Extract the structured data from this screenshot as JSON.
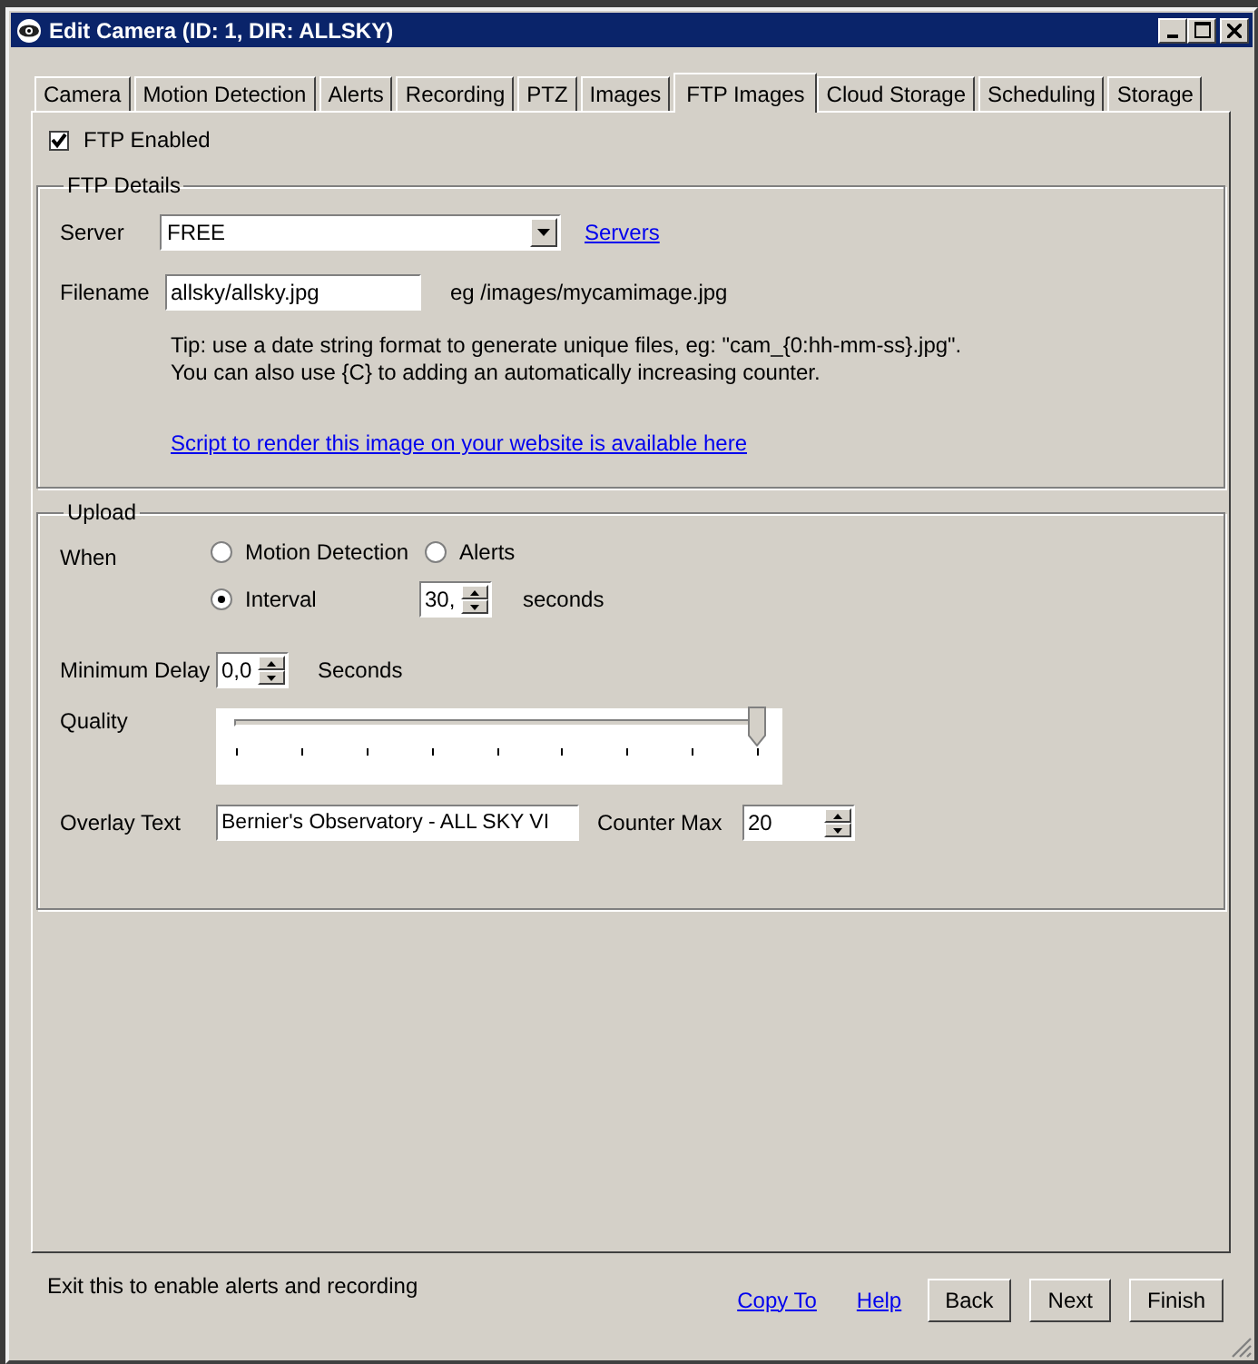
{
  "window": {
    "title": "Edit Camera (ID: 1, DIR: ALLSKY)"
  },
  "tabs": [
    {
      "label": "Camera",
      "selected": false
    },
    {
      "label": "Motion Detection",
      "selected": false
    },
    {
      "label": "Alerts",
      "selected": false
    },
    {
      "label": "Recording",
      "selected": false
    },
    {
      "label": "PTZ",
      "selected": false
    },
    {
      "label": "Images",
      "selected": false
    },
    {
      "label": "FTP Images",
      "selected": true
    },
    {
      "label": "Cloud Storage",
      "selected": false
    },
    {
      "label": "Scheduling",
      "selected": false
    },
    {
      "label": "Storage",
      "selected": false
    }
  ],
  "ftp_enabled": {
    "label": "FTP Enabled",
    "checked": true
  },
  "ftp_details": {
    "title": "FTP Details",
    "server": {
      "label": "Server",
      "value": "FREE"
    },
    "servers_link": "Servers",
    "filename": {
      "label": "Filename",
      "value": "allsky/allsky.jpg"
    },
    "example": "eg /images/mycamimage.jpg",
    "tip": "Tip: use a date string format to generate unique files, eg: \"cam_{0:hh-mm-ss}.jpg\".\nYou can also use {C} to adding an automatically increasing counter.",
    "script_link": "Script to render this image on your website is available here"
  },
  "upload": {
    "title": "Upload",
    "when_label": "When",
    "options": [
      {
        "label": "Motion Detection",
        "selected": false
      },
      {
        "label": "Alerts",
        "selected": false
      },
      {
        "label": "Interval",
        "selected": true
      }
    ],
    "interval": {
      "value": "30,",
      "unit": "seconds"
    },
    "min_delay": {
      "label": "Minimum Delay",
      "value": "0,0",
      "unit": "Seconds"
    },
    "quality": {
      "label": "Quality",
      "level": 1
    },
    "overlay": {
      "label": "Overlay Text",
      "value": "Bernier's Observatory - ALL SKY VI"
    },
    "counter_max": {
      "label": "Counter Max",
      "value": "20"
    }
  },
  "footer": {
    "status": "Exit this to enable alerts and recording",
    "links": [
      "Copy To",
      "Help"
    ],
    "buttons": [
      "Back",
      "Next",
      "Finish"
    ]
  }
}
